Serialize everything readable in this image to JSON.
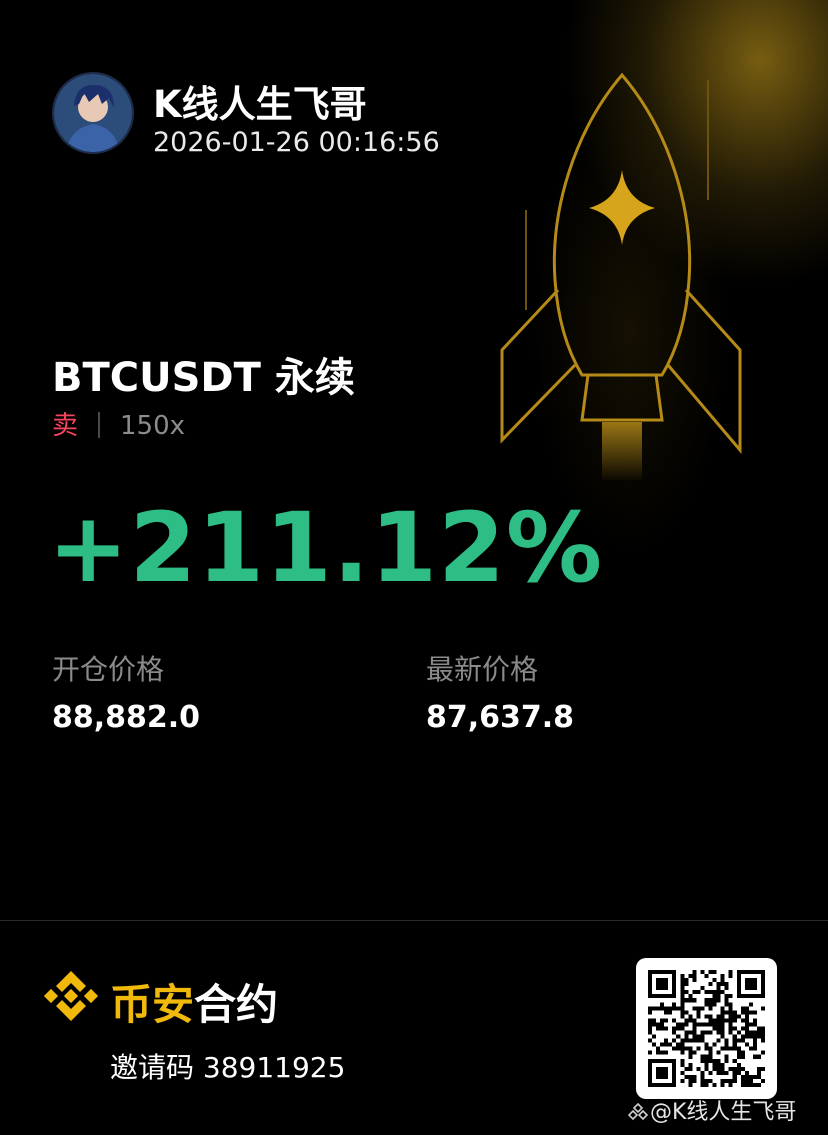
{
  "profile": {
    "username": "K线人生飞哥",
    "timestamp": "2026-01-26 00:16:56"
  },
  "position": {
    "symbol": "BTCUSDT 永续",
    "side": "卖",
    "leverage": "150x",
    "pnl_percent": "+211.12%"
  },
  "prices": {
    "entry_label": "开仓价格",
    "entry_value": "88,882.0",
    "latest_label": "最新价格",
    "latest_value": "87,637.8"
  },
  "footer": {
    "brand_part1": "币安",
    "brand_part2": "合约",
    "invite_label": "邀请码",
    "invite_code": "38911925",
    "watermark": "@K线人生飞哥"
  },
  "colors": {
    "background": "#000000",
    "profit": "#2ebd85",
    "sell": "#f6465d",
    "brand": "#f0b90b",
    "label": "#8a8a8a"
  },
  "icons": {
    "brand_logo": "binance-logo-icon",
    "decoration": "rocket-icon",
    "qr": "qr-code-icon"
  }
}
